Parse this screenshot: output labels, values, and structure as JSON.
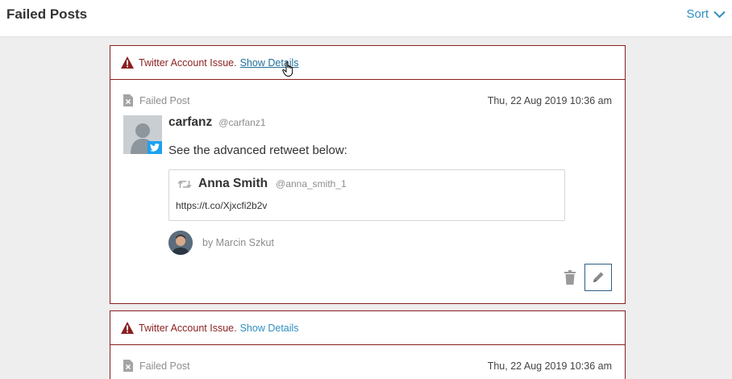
{
  "header": {
    "title": "Failed Posts",
    "sort_label": "Sort"
  },
  "posts": [
    {
      "issue": {
        "text": "Twitter Account Issue.",
        "details_link": "Show Details"
      },
      "status": "Failed Post",
      "date": "Thu, 22 Aug 2019 10:36 am",
      "author": {
        "name": "carfanz",
        "handle": "@carfanz1"
      },
      "text": "See the advanced retweet below:",
      "quoted": {
        "name": "Anna Smith",
        "handle": "@anna_smith_1",
        "url": "https://t.co/Xjxcfi2b2v"
      },
      "by": "by Marcin Szkut"
    },
    {
      "issue": {
        "text": "Twitter Account Issue.",
        "details_link": "Show Details"
      },
      "status": "Failed Post",
      "date": "Thu, 22 Aug 2019 10:36 am"
    }
  ],
  "colors": {
    "accent": "#2f8fc1",
    "error": "#8a1f1f",
    "twitter": "#1da1f2"
  }
}
